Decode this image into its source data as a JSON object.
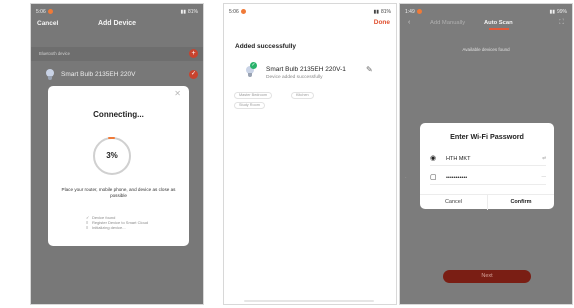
{
  "screen1": {
    "status_time": "5:06",
    "status_right": "81%",
    "nav_cancel": "Cancel",
    "nav_title": "Add Device",
    "section_label": "Bluetooth device",
    "device_name": "Smart Bulb  2135EH 220V",
    "dialog": {
      "heading": "Connecting...",
      "progress_text": "3%",
      "progress": 0.03,
      "hint": "Place your router, mobile phone, and device as close as possible",
      "steps": [
        {
          "mark": "✓",
          "label": "Device found"
        },
        {
          "mark": "≡",
          "label": "Register Device to Smart Cloud"
        },
        {
          "mark": "≡",
          "label": "Initializing device..."
        }
      ]
    }
  },
  "screen2": {
    "status_time": "5:06",
    "status_right": "81%",
    "done_label": "Done",
    "heading": "Added successfully",
    "device_name": "Smart Bulb  2135EH 220V-1",
    "device_status": "Device added successfully",
    "rooms": [
      "Master Bedroom",
      "Kitchen",
      "Study Room"
    ]
  },
  "screen3": {
    "status_time": "1:49",
    "status_right": "99%",
    "tab_manual": "Add Manually",
    "tab_auto": "Auto Scan",
    "available_text": "Available devices found",
    "dialog": {
      "heading": "Enter Wi-Fi Password",
      "ssid": "HTH MKT",
      "password_masked": "•••••••••••",
      "cancel_label": "Cancel",
      "confirm_label": "Confirm"
    },
    "next_label": "Next"
  },
  "colors": {
    "accent": "#e0502f",
    "success": "#28b26a",
    "overlay": "#787878"
  }
}
